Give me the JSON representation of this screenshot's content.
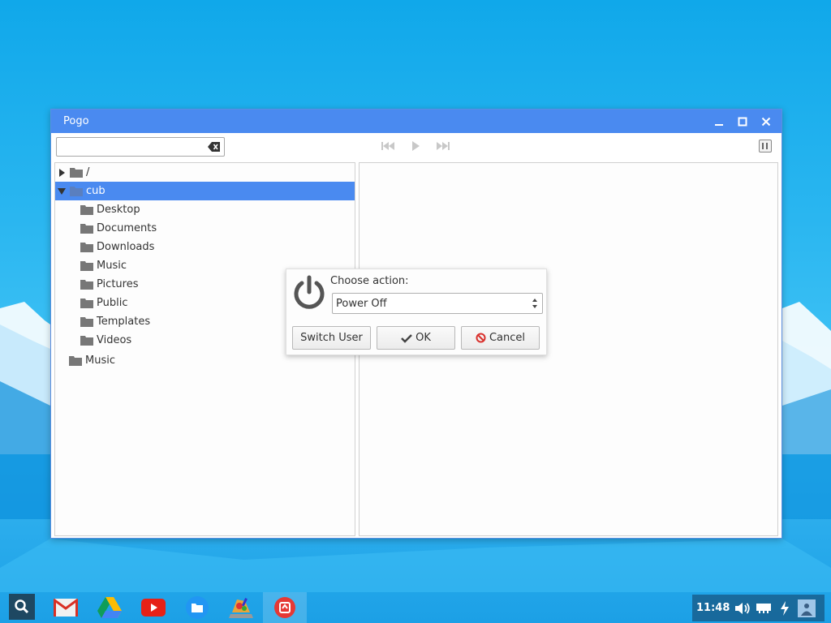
{
  "window": {
    "title": "Pogo",
    "controls": [
      "minimize-icon",
      "maximize-icon",
      "close-icon"
    ]
  },
  "toolbar": {
    "search_value": "",
    "search_placeholder": "",
    "media_controls": [
      "previous-track-icon",
      "play-icon",
      "next-track-icon"
    ]
  },
  "tree": {
    "items": [
      {
        "label": "/",
        "expanded": false,
        "selected": false
      },
      {
        "label": "cub",
        "expanded": true,
        "selected": true
      },
      {
        "label": "Desktop"
      },
      {
        "label": "Documents"
      },
      {
        "label": "Downloads"
      },
      {
        "label": "Music"
      },
      {
        "label": "Pictures"
      },
      {
        "label": "Public"
      },
      {
        "label": "Templates"
      },
      {
        "label": "Videos"
      },
      {
        "label": "Music"
      }
    ]
  },
  "dialog": {
    "prompt": "Choose action:",
    "selected_action": "Power Off",
    "buttons": {
      "switch_user": "Switch User",
      "ok": "OK",
      "cancel": "Cancel"
    }
  },
  "shelf": {
    "apps": [
      "search-icon",
      "gmail-icon",
      "drive-icon",
      "youtube-icon",
      "files-icon",
      "paint-app-icon",
      "active-app-icon"
    ],
    "clock": "11:48"
  },
  "colors": {
    "accent": "#4a8af0",
    "desktop": "#2ab6f0",
    "cancel_red": "#d9302c"
  }
}
